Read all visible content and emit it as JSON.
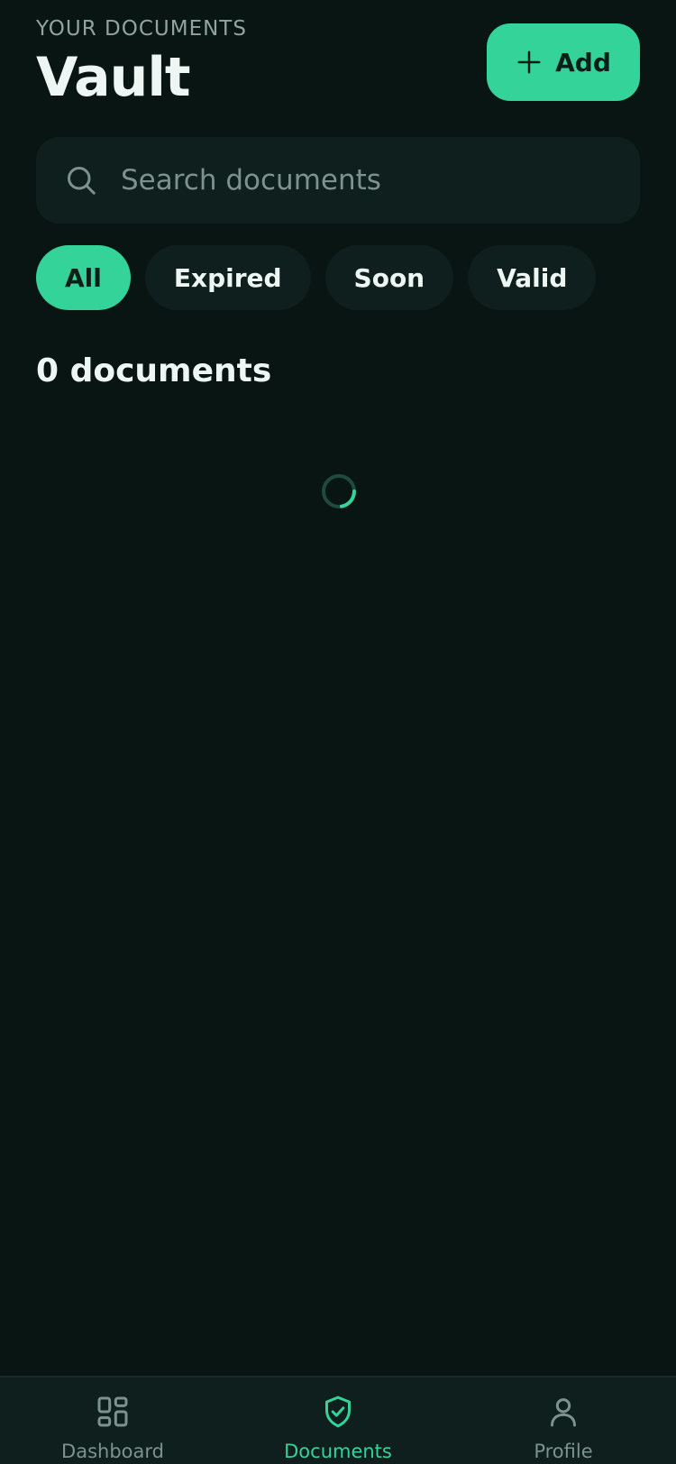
{
  "header": {
    "eyebrow": "YOUR DOCUMENTS",
    "title": "Vault",
    "add_label": "Add"
  },
  "search": {
    "placeholder": "Search documents",
    "value": ""
  },
  "filters": [
    {
      "label": "All",
      "active": true
    },
    {
      "label": "Expired",
      "active": false
    },
    {
      "label": "Soon",
      "active": false
    },
    {
      "label": "Valid",
      "active": false
    }
  ],
  "documents": {
    "count_label": "0 documents",
    "loading": true
  },
  "tabbar": {
    "items": [
      {
        "label": "Dashboard",
        "icon": "grid-icon",
        "active": false
      },
      {
        "label": "Documents",
        "icon": "shield-check-icon",
        "active": true
      },
      {
        "label": "Profile",
        "icon": "user-icon",
        "active": false
      }
    ]
  },
  "colors": {
    "background": "#081513",
    "surface": "#0f1f1d",
    "accent": "#34d399",
    "text": "#eef6f4",
    "muted": "#7d918d"
  }
}
